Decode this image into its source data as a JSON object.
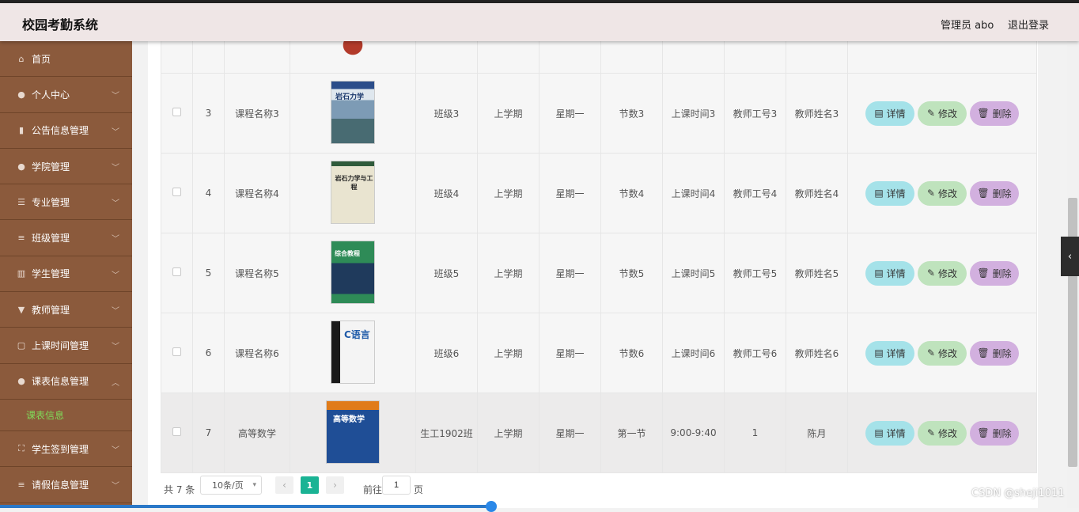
{
  "header": {
    "app_title": "校园考勤系统",
    "admin_label": "管理员 abo",
    "logout_label": "退出登录"
  },
  "sidebar": {
    "items": [
      {
        "label": "首页",
        "icon": "home-icon"
      },
      {
        "label": "个人中心",
        "icon": "user-icon"
      },
      {
        "label": "公告信息管理",
        "icon": "mic-icon"
      },
      {
        "label": "学院管理",
        "icon": "location-icon"
      },
      {
        "label": "专业管理",
        "icon": "sliders-icon"
      },
      {
        "label": "班级管理",
        "icon": "list-icon"
      },
      {
        "label": "学生管理",
        "icon": "chart-icon"
      },
      {
        "label": "教师管理",
        "icon": "medal-icon"
      },
      {
        "label": "上课时间管理",
        "icon": "message-icon"
      },
      {
        "label": "课表信息管理",
        "icon": "user-icon"
      }
    ],
    "sub_item": "课表信息",
    "items_after": [
      {
        "label": "学生签到管理",
        "icon": "frame-icon"
      },
      {
        "label": "请假信息管理",
        "icon": "list-icon"
      }
    ]
  },
  "table": {
    "rows": [
      {
        "no": "3",
        "course": "课程名称3",
        "cover_title": "岩石力学",
        "cls": "班级3",
        "term": "上学期",
        "day": "星期一",
        "period": "节数3",
        "time": "上课时间3",
        "tid": "教师工号3",
        "tname": "教师姓名3"
      },
      {
        "no": "4",
        "course": "课程名称4",
        "cover_title": "岩石力学与工程",
        "cls": "班级4",
        "term": "上学期",
        "day": "星期一",
        "period": "节数4",
        "time": "上课时间4",
        "tid": "教师工号4",
        "tname": "教师姓名4"
      },
      {
        "no": "5",
        "course": "课程名称5",
        "cover_title": "综合教程",
        "cls": "班级5",
        "term": "上学期",
        "day": "星期一",
        "period": "节数5",
        "time": "上课时间5",
        "tid": "教师工号5",
        "tname": "教师姓名5"
      },
      {
        "no": "6",
        "course": "课程名称6",
        "cover_title": "C语言",
        "cls": "班级6",
        "term": "上学期",
        "day": "星期一",
        "period": "节数6",
        "time": "上课时间6",
        "tid": "教师工号6",
        "tname": "教师姓名6"
      },
      {
        "no": "7",
        "course": "高等数学",
        "cover_title": "高等数学",
        "cls": "生工1902班",
        "term": "上学期",
        "day": "星期一",
        "period": "第一节",
        "time": "9:00-9:40",
        "tid": "1",
        "tname": "陈月"
      }
    ],
    "actions": {
      "detail": "详情",
      "edit": "修改",
      "delete": "删除"
    }
  },
  "pager": {
    "total": "共 7 条",
    "page_size": "10条/页",
    "current": "1",
    "goto": "前往",
    "goto_value": "1",
    "page_suffix": "页"
  },
  "watermark": "CSDN @sheji1011",
  "colors": {
    "sidebar_bg": "#8b5a3c",
    "active_sub": "#7fdc5a",
    "pager_active": "#1ab394"
  }
}
